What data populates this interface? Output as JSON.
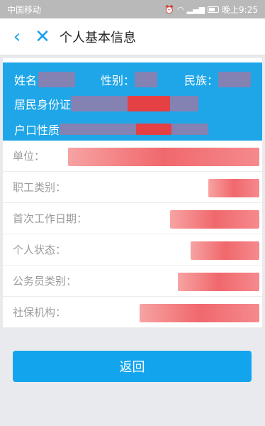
{
  "status_bar": {
    "carrier": "中国移动",
    "time": "晚上9:25"
  },
  "header": {
    "back_icon": "chevron-left-icon",
    "close_icon": "close-icon",
    "title": "个人基本信息"
  },
  "info_card": {
    "name_label": "姓名",
    "gender_label": "性别：",
    "ethnicity_label": "民族：",
    "id_label": "居民身份证",
    "household_label": "户口性质"
  },
  "fields": [
    {
      "label": "单位：",
      "value_fraction": 0.75
    },
    {
      "label": "职工类别：",
      "value_fraction": 0.2
    },
    {
      "label": "首次工作日期：",
      "value_fraction": 0.35
    },
    {
      "label": "个人状态：",
      "value_fraction": 0.27
    },
    {
      "label": "公务员类别：",
      "value_fraction": 0.32
    },
    {
      "label": "社保机构：",
      "value_fraction": 0.47
    }
  ],
  "return_button": "返回",
  "colors": {
    "accent": "#12a5ee",
    "card": "#1ea6e8"
  }
}
